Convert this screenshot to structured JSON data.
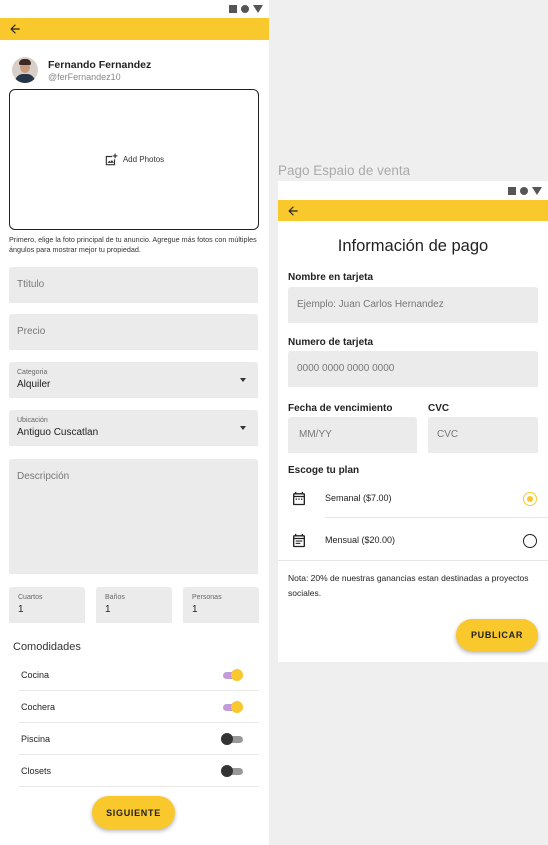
{
  "colors": {
    "accent": "#f9c82c",
    "toggle_track_on": "#c39bd6",
    "field_bg": "#ebebeb"
  },
  "left": {
    "profile": {
      "name": "Fernando Fernandez",
      "username": "@ferFernandez10"
    },
    "photo_box": {
      "label": "Add Photos",
      "icon": "add-photo-icon"
    },
    "photo_hint": "Primero, elige la foto principal de tu anuncio. Agregue más fotos con múltiples ángulos para mostrar mejor tu propiedad.",
    "fields": {
      "titulo_placeholder": "Ttitulo",
      "precio_placeholder": "Precio",
      "categoria_label": "Categoria",
      "categoria_value": "Alquiler",
      "ubicacion_label": "Ubicación",
      "ubicacion_value": "Antiguo Cuscatlan",
      "descripcion_placeholder": "Descripción"
    },
    "counters": [
      {
        "label": "Cuartos",
        "value": "1"
      },
      {
        "label": "Baños",
        "value": "1"
      },
      {
        "label": "Personas",
        "value": "1"
      }
    ],
    "amenities_title": "Comodidades",
    "amenities": [
      {
        "label": "Cocina",
        "on": true
      },
      {
        "label": "Cochera",
        "on": true
      },
      {
        "label": "Piscina",
        "on": false
      },
      {
        "label": "Closets",
        "on": false
      }
    ],
    "next_button": "SIGUIENTE"
  },
  "right": {
    "screen_title": "Pago Espaio de venta",
    "heading": "Información de pago",
    "name_label": "Nombre en tarjeta",
    "name_placeholder": "Ejemplo: Juan Carlos Hernandez",
    "number_label": "Numero de tarjeta",
    "number_placeholder": "0000 0000 0000 0000",
    "expiry_label": "Fecha de vencimiento",
    "expiry_placeholder": "MM/YY",
    "cvc_label": "CVC",
    "cvc_placeholder": "CVC",
    "plan_label": "Escoge tu plan",
    "plans": [
      {
        "label": "Semanal ($7.00)",
        "selected": true
      },
      {
        "label": "Mensual ($20.00)",
        "selected": false
      }
    ],
    "note": "Nota: 20% de nuestras ganancias estan destinadas a proyectos sociales.",
    "publish_button": "PUBLICAR"
  }
}
